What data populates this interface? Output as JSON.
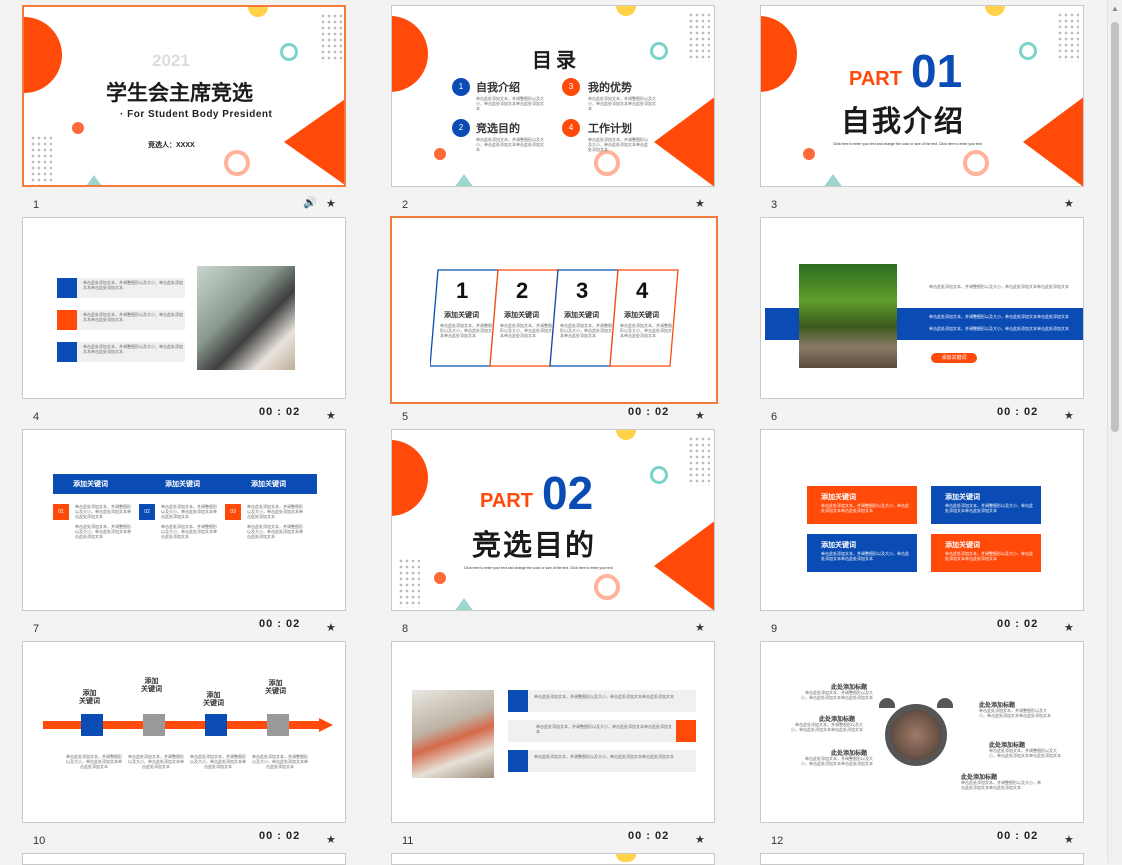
{
  "slides": [
    {
      "num": "1",
      "title": "学生会主席竞选",
      "year": "2021",
      "subtitle": "· For Student Body President",
      "candidate": "竞选人：XXXX",
      "speaker_icon": "speaker-icon",
      "star": "★"
    },
    {
      "num": "2",
      "title": "目录",
      "items": [
        {
          "n": "1",
          "label": "自我介绍"
        },
        {
          "n": "3",
          "label": "我的优势"
        },
        {
          "n": "2",
          "label": "竞选目的"
        },
        {
          "n": "4",
          "label": "工作计划"
        }
      ],
      "star": "★"
    },
    {
      "num": "3",
      "part_label": "PART",
      "part_num": "01",
      "title": "自我介绍",
      "caption": "Click here to enter your text and change the color or size of the text. Click here to enter your text",
      "star": "★"
    },
    {
      "num": "4",
      "duration": "00 : 02",
      "star": "★"
    },
    {
      "num": "5",
      "duration": "00 : 02",
      "cards": [
        {
          "n": "1",
          "kw": "添加关键词"
        },
        {
          "n": "2",
          "kw": "添加关键词"
        },
        {
          "n": "3",
          "kw": "添加关键词"
        },
        {
          "n": "4",
          "kw": "添加关键词"
        }
      ],
      "star": "★"
    },
    {
      "num": "6",
      "duration": "00 : 02",
      "tag": "添加关键词",
      "star": "★"
    },
    {
      "num": "7",
      "duration": "00 : 02",
      "headers": [
        "添加关键词",
        "添加关键词",
        "添加关键词"
      ],
      "badges": [
        "01",
        "02",
        "03"
      ],
      "star": "★"
    },
    {
      "num": "8",
      "part_label": "PART",
      "part_num": "02",
      "title": "竞选目的",
      "caption": "Click here to enter your text and change the color or size of the text. Click here to enter your text",
      "star": "★"
    },
    {
      "num": "9",
      "duration": "00 : 02",
      "boxes": [
        "添加关键词",
        "添加关键词",
        "添加关键词",
        "添加关键词"
      ],
      "star": "★"
    },
    {
      "num": "10",
      "duration": "00 : 02",
      "labels": [
        "添加\n关键词",
        "添加\n关键词",
        "添加\n关键词",
        "添加\n关键词"
      ],
      "star": "★"
    },
    {
      "num": "11",
      "duration": "00 : 02",
      "star": "★"
    },
    {
      "num": "12",
      "duration": "00 : 02",
      "headings": [
        "此处添加标题",
        "此处添加标题",
        "此处添加标题",
        "此处添加标题",
        "此处添加标题"
      ],
      "star": "★"
    }
  ],
  "lorem": "单击此处添加文本，并调整图形以及大小，单击此处添加文本单击此处添加文本"
}
